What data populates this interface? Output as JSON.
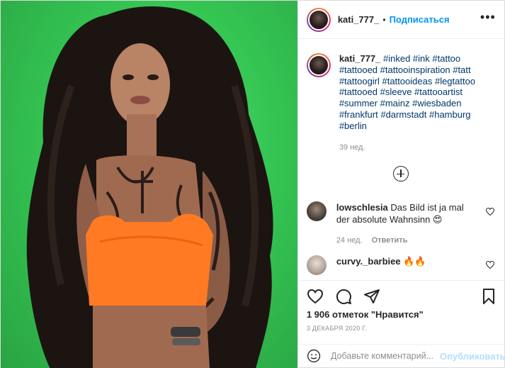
{
  "post": {
    "username": "kati_777_",
    "follow_label": "Подписаться",
    "more_label": "•••",
    "caption": {
      "username": "kati_777_",
      "lines": [
        "#inked #ink #tattoo",
        "#tattooed #tattooinspiration #tatt",
        "#tattoogirl #tattooideas #legtattoo",
        "#tattooed #sleeve #tattooartist",
        "#summer #mainz #wiesbaden",
        "#frankfurt #darmstadt #hamburg",
        "#berlin"
      ],
      "time_ago": "39 нед."
    },
    "comments": [
      {
        "username": "lowschlesia",
        "text": "Das Bild ist ja mal der absolute Wahnsinn 😍",
        "time_ago": "24 нед.",
        "reply_label": "Ответить"
      },
      {
        "username": "curvy._barbiee",
        "text": "🔥🔥"
      }
    ],
    "likes": "1 906 отметок \"Нравится\"",
    "date": "3 ДЕКАБРЯ 2020 Г.",
    "add_comment_placeholder": "Добавьте комментарий...",
    "publish_label": "Опубликовать",
    "colors": {
      "accent": "#0095f6",
      "hashtag": "#00376b",
      "muted": "#8e8e8e",
      "photo_bg": "#35c653",
      "top_color": "#ff7a22"
    }
  }
}
